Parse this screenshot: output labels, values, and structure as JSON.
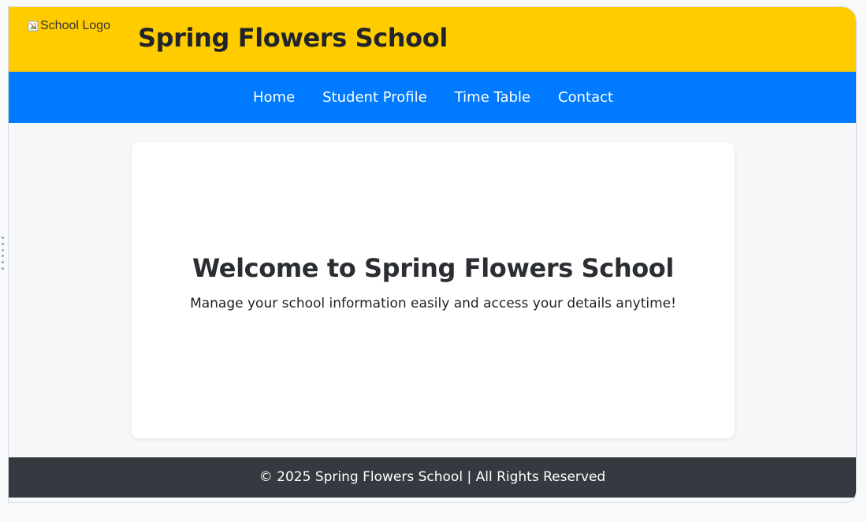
{
  "header": {
    "logo_alt_text": "School Logo",
    "logo_icon": "broken-image-icon",
    "title": "Spring Flowers School",
    "background_color": "#ffcc00"
  },
  "nav": {
    "background_color": "#007bff",
    "items": [
      {
        "label": "Home"
      },
      {
        "label": "Student Profile"
      },
      {
        "label": "Time Table"
      },
      {
        "label": "Contact"
      }
    ]
  },
  "main": {
    "welcome_title": "Welcome to Spring Flowers School",
    "welcome_subtitle": "Manage your school information easily and access your details anytime!"
  },
  "footer": {
    "text": "© 2025 Spring Flowers School | All Rights Reserved",
    "background_color": "#343a40"
  }
}
